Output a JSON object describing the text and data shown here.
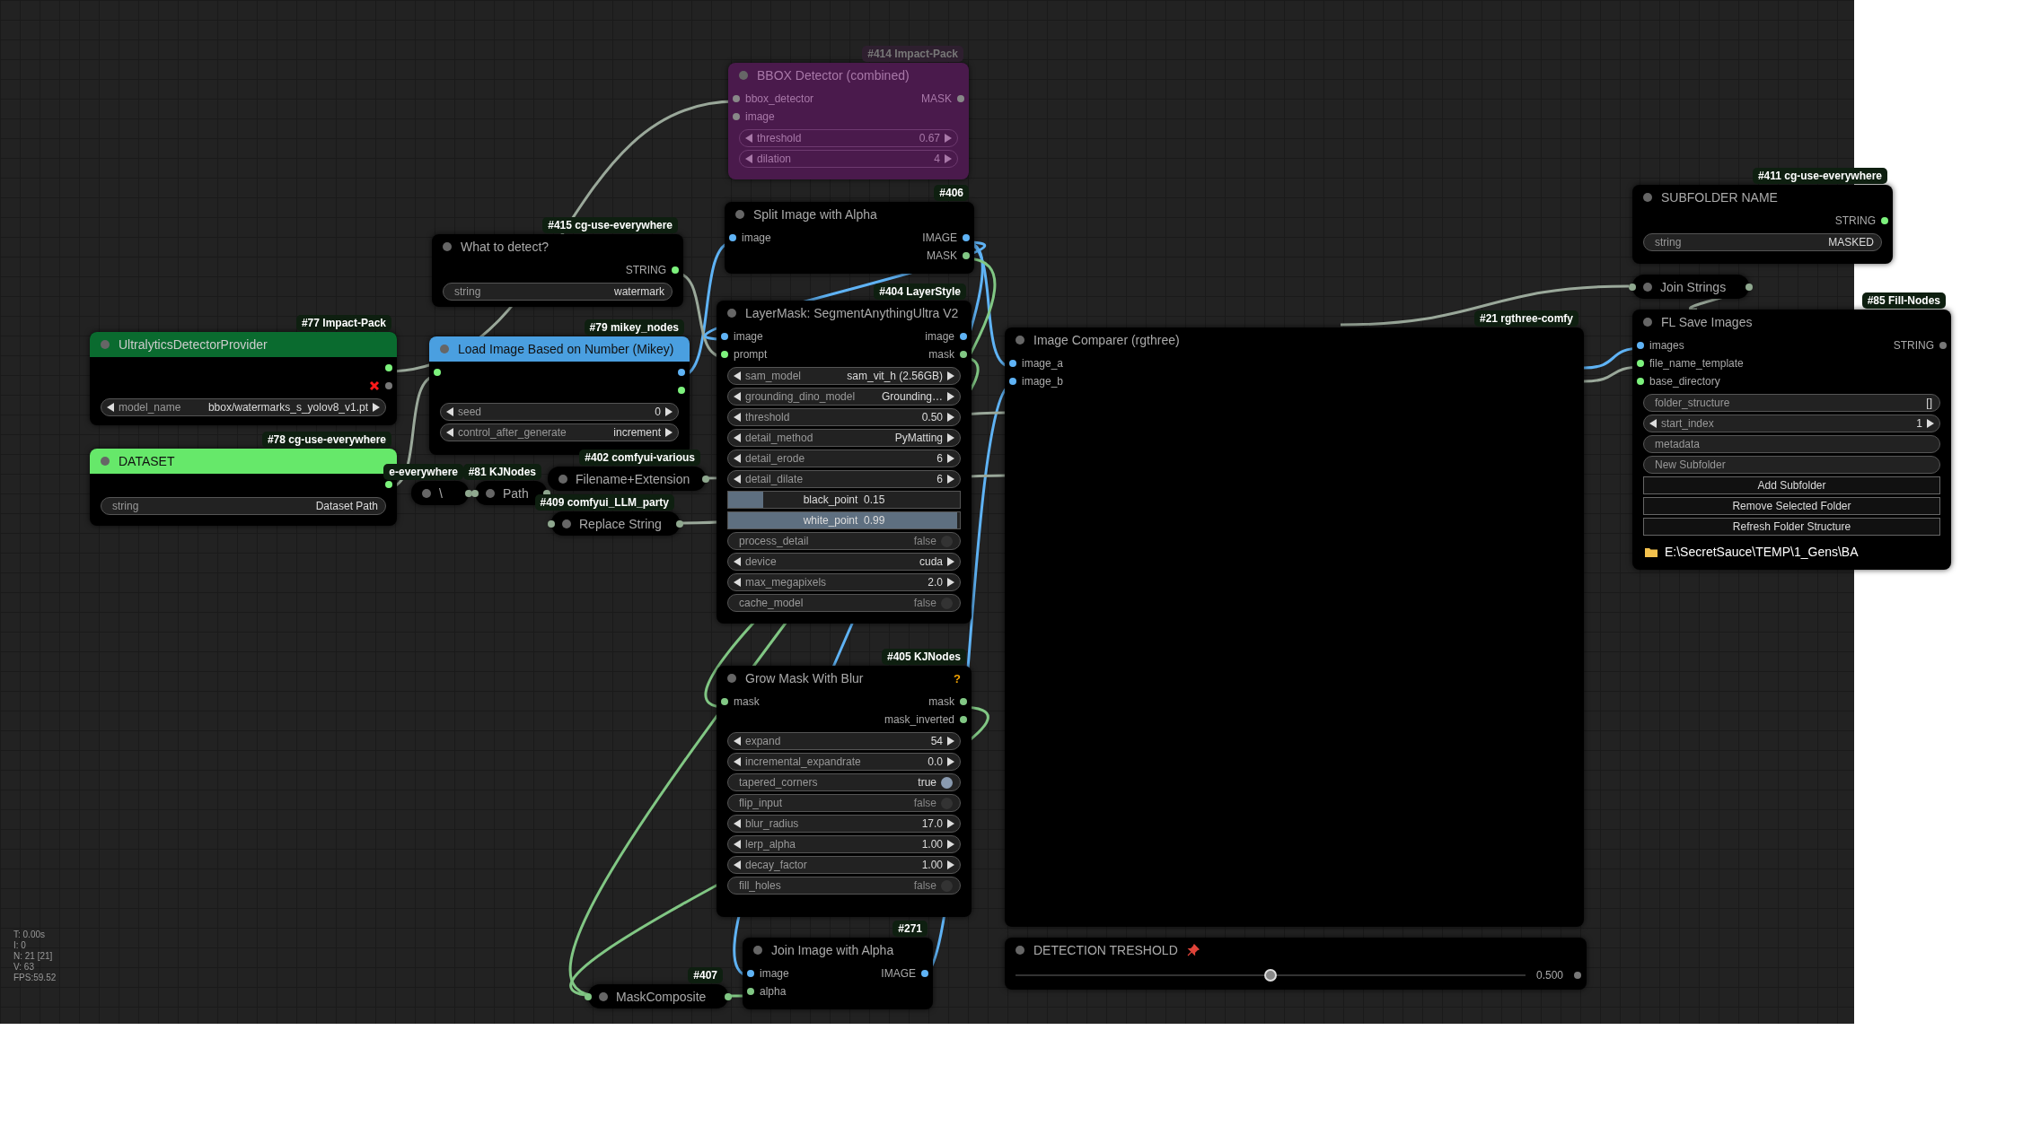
{
  "nodes": [
    {
      "title": "BBOX Detector (combined)",
      "badge": "#414 Impact-Pack",
      "bypassed": true,
      "collapsed": false,
      "inputs": [
        {
          "label": "bbox_detector",
          "color": "#888888"
        },
        {
          "label": "image",
          "color": "#888888"
        }
      ],
      "outputs": [
        {
          "label": "MASK",
          "color": "#888888"
        }
      ],
      "widgets": [
        {
          "kind": "combo",
          "label": "threshold",
          "value": "0.67"
        },
        {
          "kind": "combo",
          "label": "dilation",
          "value": "4"
        }
      ]
    },
    {
      "title": "What to detect?",
      "badge": "#415 cg-use-everywhere",
      "bypassed": false,
      "collapsed": false,
      "outputs": [
        {
          "label": "STRING",
          "color": "#7df27d"
        }
      ],
      "widgets": [
        {
          "kind": "text",
          "label": "string",
          "value": "watermark"
        }
      ]
    },
    {
      "title": "UltralyticsDetectorProvider",
      "badge": "#77 Impact-Pack",
      "color": "#0a6b2f",
      "bypassed": false,
      "collapsed": false,
      "outputs": [
        {
          "color": "#7df27d"
        },
        {
          "color": "#777777",
          "error": true
        }
      ],
      "widgets": [
        {
          "kind": "combo",
          "label": "model_name",
          "value": "bbox/watermarks_s_yolov8_v1.pt"
        }
      ]
    },
    {
      "title": "DATASET",
      "badge": "#78 cg-use-everywhere",
      "color": "#66e86a",
      "bypassed": false,
      "collapsed": false,
      "outputs": [
        {
          "color": "#7df27d"
        }
      ],
      "widgets": [
        {
          "kind": "text",
          "label": "string",
          "value": "Dataset Path"
        }
      ]
    },
    {
      "title": "Load Image Based on Number (Mikey)",
      "badge": "#79 mikey_nodes",
      "color": "#4a9fe0",
      "bypassed": false,
      "collapsed": false,
      "inputs": [
        {
          "color": "#7df27d"
        }
      ],
      "outputs": [
        {
          "color": "#5fb3f5"
        },
        {
          "color": "#7df27d"
        }
      ],
      "widgets": [
        {
          "kind": "combo",
          "label": "seed",
          "value": "0"
        },
        {
          "kind": "combo",
          "label": "control_after_generate",
          "value": "increment"
        }
      ]
    },
    {
      "title": "\\",
      "badge": "e-everywhere",
      "bypassed": false,
      "collapsed": true,
      "outputs": [
        {
          "color": "#8fa88f"
        }
      ]
    },
    {
      "title": "Path",
      "badge": "#81 KJNodes",
      "bypassed": false,
      "collapsed": true,
      "inputs": [
        {
          "color": "#8fa88f"
        }
      ],
      "outputs": [
        {
          "color": "#8fa88f"
        }
      ]
    },
    {
      "title": "Filename+Extension",
      "badge": "#402 comfyui-various",
      "bypassed": false,
      "collapsed": true,
      "outputs": [
        {
          "color": "#8fa88f"
        }
      ]
    },
    {
      "title": "Replace String",
      "badge": "#409 comfyui_LLM_party",
      "bypassed": false,
      "collapsed": true,
      "inputs": [
        {
          "color": "#8fa88f"
        }
      ],
      "outputs": [
        {
          "color": "#8fa88f"
        }
      ]
    },
    {
      "title": "Split Image with Alpha",
      "badge": "#406",
      "bypassed": false,
      "collapsed": false,
      "inputs": [
        {
          "label": "image",
          "color": "#5fb3f5"
        }
      ],
      "outputs": [
        {
          "label": "IMAGE",
          "color": "#5fb3f5"
        },
        {
          "label": "MASK",
          "color": "#81c784"
        }
      ]
    },
    {
      "title": "LayerMask: SegmentAnythingUltra V2",
      "badge": "#404 LayerStyle",
      "bypassed": false,
      "collapsed": false,
      "inputs": [
        {
          "label": "image",
          "color": "#5fb3f5"
        },
        {
          "label": "prompt",
          "color": "#7df27d"
        }
      ],
      "outputs": [
        {
          "label": "image",
          "color": "#5fb3f5"
        },
        {
          "label": "mask",
          "color": "#81c784"
        }
      ],
      "widgets": [
        {
          "kind": "combo",
          "label": "sam_model",
          "value": "sam_vit_h (2.56GB)"
        },
        {
          "kind": "combo",
          "label": "grounding_dino_model",
          "value": "Grounding…"
        },
        {
          "kind": "combo",
          "label": "threshold",
          "value": "0.50"
        },
        {
          "kind": "combo",
          "label": "detail_method",
          "value": "PyMatting"
        },
        {
          "kind": "combo",
          "label": "detail_erode",
          "value": "6"
        },
        {
          "kind": "combo",
          "label": "detail_dilate",
          "value": "6"
        },
        {
          "kind": "slider",
          "label": "black_point",
          "value": "0.15",
          "level": 0.15
        },
        {
          "kind": "slider",
          "label": "white_point",
          "value": "0.99",
          "level": 0.99
        },
        {
          "kind": "toggle",
          "label": "process_detail",
          "value": "false",
          "on": false
        },
        {
          "kind": "combo",
          "label": "device",
          "value": "cuda"
        },
        {
          "kind": "combo",
          "label": "max_megapixels",
          "value": "2.0"
        },
        {
          "kind": "toggle",
          "label": "cache_model",
          "value": "false",
          "on": false
        }
      ]
    },
    {
      "title": "Grow Mask With Blur",
      "badge": "#405 KJNodes",
      "help": "?",
      "bypassed": false,
      "collapsed": false,
      "inputs": [
        {
          "label": "mask",
          "color": "#81c784"
        }
      ],
      "outputs": [
        {
          "label": "mask",
          "color": "#81c784"
        },
        {
          "label": "mask_inverted",
          "color": "#81c784"
        }
      ],
      "widgets": [
        {
          "kind": "combo",
          "label": "expand",
          "value": "54"
        },
        {
          "kind": "combo",
          "label": "incremental_expandrate",
          "value": "0.0"
        },
        {
          "kind": "toggle",
          "label": "tapered_corners",
          "value": "true",
          "on": true
        },
        {
          "kind": "toggle",
          "label": "flip_input",
          "value": "false",
          "on": false
        },
        {
          "kind": "combo",
          "label": "blur_radius",
          "value": "17.0"
        },
        {
          "kind": "combo",
          "label": "lerp_alpha",
          "value": "1.00"
        },
        {
          "kind": "combo",
          "label": "decay_factor",
          "value": "1.00"
        },
        {
          "kind": "toggle",
          "label": "fill_holes",
          "value": "false",
          "on": false
        }
      ]
    },
    {
      "title": "Image Comparer (rgthree)",
      "badge": "#21 rgthree-comfy",
      "bypassed": false,
      "collapsed": false,
      "inputs": [
        {
          "label": "image_a",
          "color": "#5fb3f5"
        },
        {
          "label": "image_b",
          "color": "#5fb3f5"
        }
      ]
    },
    {
      "title": "Join Image with Alpha",
      "badge": "#271",
      "bypassed": false,
      "collapsed": false,
      "inputs": [
        {
          "label": "image",
          "color": "#5fb3f5"
        },
        {
          "label": "alpha",
          "color": "#81c784"
        }
      ],
      "outputs": [
        {
          "label": "IMAGE",
          "color": "#5fb3f5"
        }
      ]
    },
    {
      "title": "MaskComposite",
      "badge": "#407",
      "bypassed": false,
      "collapsed": true,
      "inputs": [
        {
          "color": "#81c784"
        }
      ],
      "outputs": [
        {
          "color": "#81c784"
        }
      ]
    },
    {
      "title": "DETECTION TRESHOLD",
      "pinned": true,
      "bypassed": false,
      "collapsed": false,
      "slider": {
        "level": 0.5,
        "value": "0.500",
        "color": "#777777"
      }
    },
    {
      "title": "SUBFOLDER NAME",
      "badge": "#411 cg-use-everywhere",
      "bypassed": false,
      "collapsed": false,
      "outputs": [
        {
          "label": "STRING",
          "color": "#7df27d"
        }
      ],
      "widgets": [
        {
          "kind": "text",
          "label": "string",
          "value": "MASKED"
        }
      ]
    },
    {
      "title": "Join Strings",
      "bypassed": false,
      "collapsed": true,
      "inputs": [
        {
          "color": "#8fa88f"
        }
      ],
      "outputs": [
        {
          "color": "#8fa88f"
        }
      ]
    },
    {
      "title": "FL Save Images",
      "badge": "#85 Fill-Nodes",
      "bypassed": false,
      "collapsed": false,
      "inputs": [
        {
          "label": "images",
          "color": "#5fb3f5"
        },
        {
          "label": "file_name_template",
          "color": "#7df27d"
        },
        {
          "label": "base_directory",
          "color": "#7df27d"
        }
      ],
      "outputs": [
        {
          "label": "STRING",
          "color": "#777777"
        }
      ],
      "widgets": [
        {
          "kind": "text",
          "label": "folder_structure",
          "value": "[]"
        },
        {
          "kind": "combo",
          "label": "start_index",
          "value": "1"
        },
        {
          "kind": "text",
          "label": "metadata"
        },
        {
          "kind": "field",
          "placeholder": "New Subfolder"
        },
        {
          "kind": "button",
          "label": "Add Subfolder"
        },
        {
          "kind": "button",
          "label": "Remove Selected Folder"
        },
        {
          "kind": "button",
          "label": "Refresh Folder Structure"
        }
      ],
      "path": "E:\\SecretSauce\\TEMP\\1_Gens\\BA"
    }
  ],
  "stats": [
    "T: 0.00s",
    "I: 0",
    "N: 21 [21]",
    "V: 63",
    "FPS:59.52"
  ]
}
